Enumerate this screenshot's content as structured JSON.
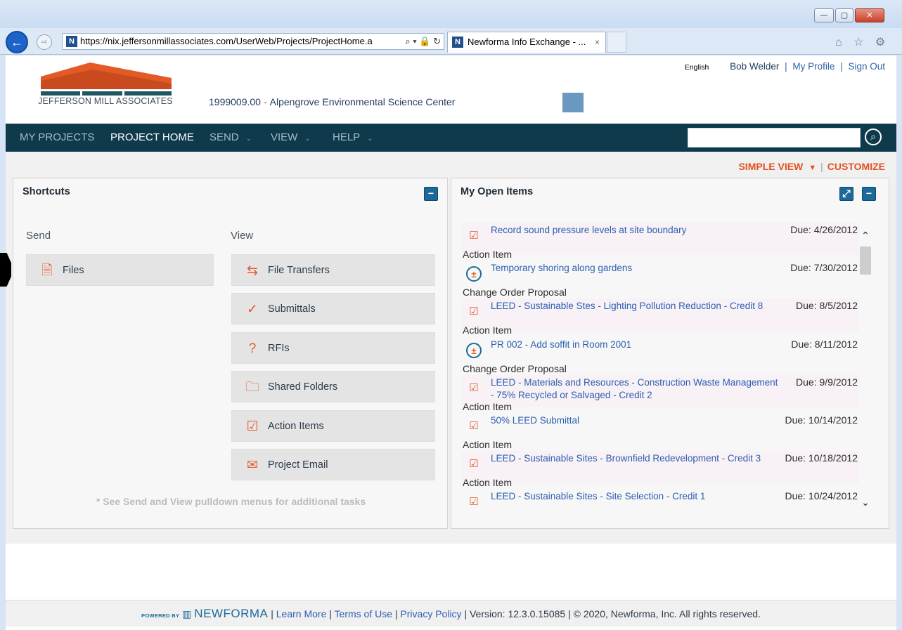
{
  "browser": {
    "back_glyph": "←",
    "forward_glyph": "⇨",
    "address_url": "https://nix.jeffersonmillassociates.com/UserWeb/Projects/ProjectHome.a",
    "address_tools": "⌕ ▾ 🔒 ↻",
    "favicon_letter": "N",
    "tab_title": "Newforma Info Exchange - ...",
    "tab_close": "×",
    "toolbar_icons": "⌂ ☆ ⚙",
    "window_min": "—",
    "window_max": "▢",
    "window_close": "✕"
  },
  "header": {
    "company_name": "JEFFERSON MILL ASSOCIATES",
    "project_number": "1999009.00",
    "project_separator": "-",
    "project_name": "Alpengrove Environmental Science Center",
    "language": "English",
    "user_name": "Bob Welder",
    "my_profile": "My Profile",
    "sign_out": "Sign Out",
    "separator": "|"
  },
  "nav": {
    "my_projects": "MY PROJECTS",
    "project_home": "PROJECT HOME",
    "send": "SEND",
    "view": "VIEW",
    "help": "HELP",
    "chevron": "⌄",
    "search_placeholder": "",
    "search_icon": "search-icon"
  },
  "view_controls": {
    "simple_view": "SIMPLE VIEW",
    "simple_view_arrow": "▼",
    "separator": "|",
    "customize": "CUSTOMIZE"
  },
  "shortcuts": {
    "title": "Shortcuts",
    "collapse_glyph": "−",
    "send_heading": "Send",
    "view_heading": "View",
    "send_items": [
      {
        "label": "Files",
        "icon": "files-icon",
        "glyph": "🗎"
      }
    ],
    "view_items": [
      {
        "label": "File Transfers",
        "icon": "file-transfers-icon",
        "glyph": "⇆"
      },
      {
        "label": "Submittals",
        "icon": "submittals-icon",
        "glyph": "✓"
      },
      {
        "label": "RFIs",
        "icon": "rfis-icon",
        "glyph": "?"
      },
      {
        "label": "Shared Folders",
        "icon": "shared-folders-icon",
        "glyph": "🗀"
      },
      {
        "label": "Action Items",
        "icon": "action-items-icon",
        "glyph": "☑"
      },
      {
        "label": "Project Email",
        "icon": "project-email-icon",
        "glyph": "✉"
      }
    ],
    "note": "* See Send and View pulldown menus for additional tasks"
  },
  "open_items": {
    "title": "My Open Items",
    "expand_glyph": "⤢",
    "collapse_glyph": "−",
    "scroll_up": "⌃",
    "scroll_down": "⌄",
    "items": [
      {
        "title": "Record sound pressure levels at site boundary",
        "due": "Due: 4/26/2012",
        "type": "Action Item",
        "icon": "action-item-icon",
        "glyph": "☑"
      },
      {
        "title": "Temporary shoring along gardens",
        "due": "Due: 7/30/2012",
        "type": "Change Order Proposal",
        "icon": "change-order-icon",
        "glyph": "±"
      },
      {
        "title": "LEED - Sustainable Stes - Lighting Pollution Reduction - Credit 8",
        "due": "Due: 8/5/2012",
        "type": "Action Item",
        "icon": "action-item-icon",
        "glyph": "☑"
      },
      {
        "title": "PR 002 - Add soffit in Room 2001",
        "due": "Due: 8/11/2012",
        "type": "Change Order Proposal",
        "icon": "change-order-icon",
        "glyph": "±"
      },
      {
        "title": "LEED - Materials and Resources - Construction Waste Management - 75% Recycled or Salvaged - Credit 2",
        "due": "Due: 9/9/2012",
        "type": "Action Item",
        "icon": "action-item-icon",
        "glyph": "☑"
      },
      {
        "title": "50% LEED Submittal",
        "due": "Due: 10/14/2012",
        "type": "Action Item",
        "icon": "action-item-icon",
        "glyph": "☑"
      },
      {
        "title": "LEED - Sustainable Sites - Brownfield Redevelopment - Credit 3",
        "due": "Due: 10/18/2012",
        "type": "Action Item",
        "icon": "action-item-icon",
        "glyph": "☑"
      },
      {
        "title": "LEED - Sustainable Sites - Site Selection - Credit 1",
        "due": "Due: 10/24/2012",
        "type": "",
        "icon": "action-item-icon",
        "glyph": "☑"
      }
    ]
  },
  "footer": {
    "powered_by": "POWERED BY",
    "brand": "NEWFORMA",
    "learn_more": "Learn More",
    "terms": "Terms of Use",
    "privacy": "Privacy Policy",
    "version": "Version: 12.3.0.15085",
    "copyright": "© 2020, Newforma, Inc. All rights reserved.",
    "separator": "|"
  },
  "colors": {
    "nav_background": "#0e3a4c",
    "accent_orange": "#e3511f",
    "link_blue": "#2c5eb0",
    "panel_button": "#1c6a9a"
  }
}
